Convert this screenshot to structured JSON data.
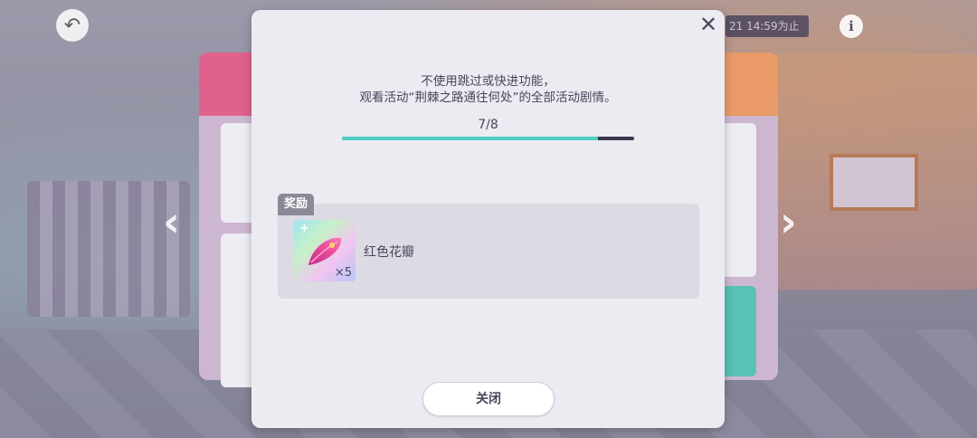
{
  "background": {
    "deadline_text": "21 14:59为止"
  },
  "modal": {
    "description_lines": [
      "不使用跳过或快进功能，",
      "观看活动“荆棘之路通往何处”的全部活动剧情。"
    ],
    "progress": {
      "text": "7/8",
      "current": 7,
      "total": 8
    },
    "reward": {
      "tag_label": "奖励",
      "item_name": "红色花瓣",
      "quantity_label": "×5",
      "icon": "red-petal-icon"
    },
    "close_button_label": "关闭"
  },
  "colors": {
    "accent": "#4ccfc2",
    "track": "#3b3850",
    "modal_bg": "#ebebf1",
    "text": "#48465a"
  }
}
